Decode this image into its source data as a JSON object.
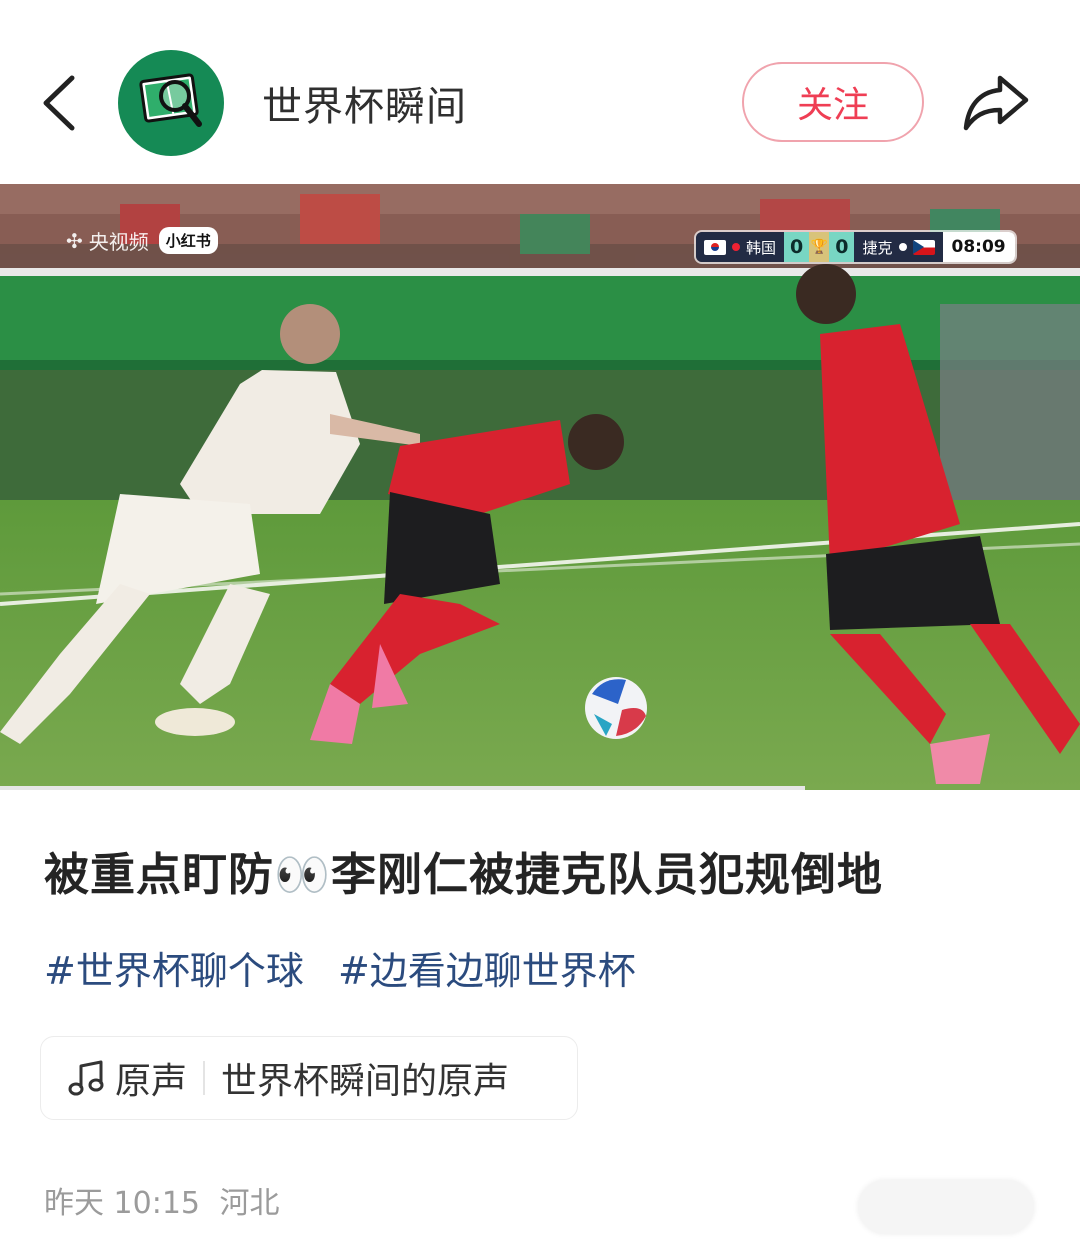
{
  "header": {
    "author_name": "世界杯瞬间",
    "follow_label": "关注"
  },
  "video": {
    "watermark": {
      "broadcaster": "央视频",
      "platform": "小红书"
    },
    "scoreboard": {
      "home_team": "韩国",
      "home_score": "0",
      "away_score": "0",
      "away_team": "捷克",
      "clock": "08:09"
    },
    "progress": 0.745
  },
  "post": {
    "title": "被重点盯防👀李刚仁被捷克队员犯规倒地",
    "tags": [
      "#世界杯聊个球",
      "#边看边聊世界杯"
    ],
    "music": {
      "label": "原声",
      "name": "世界杯瞬间的原声"
    },
    "date": "昨天 10:15",
    "location": "河北"
  },
  "icons": {
    "back": "chevron-left-icon",
    "share": "share-arrow-icon",
    "music": "music-note-icon",
    "avatar": "football-field-magnifier-icon"
  },
  "colors": {
    "follow_red": "#ef3e54",
    "tag_blue": "#2b4b7e",
    "avatar_green": "#158a55"
  }
}
